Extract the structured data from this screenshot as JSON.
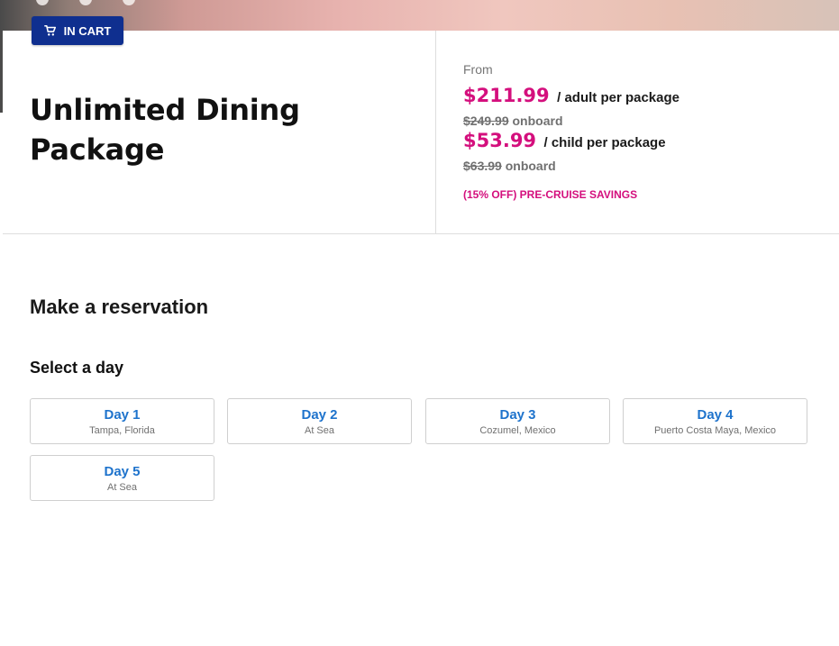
{
  "badge": {
    "label": "IN CART",
    "icon": "cart-icon"
  },
  "package": {
    "title": "Unlimited Dining Package",
    "from_label": "From",
    "adult_price": "$211.99",
    "adult_unit": "/ adult per package",
    "adult_onboard_price": "$249.99",
    "adult_onboard_label": "onboard",
    "child_price": "$53.99",
    "child_unit": "/ child per package",
    "child_onboard_price": "$63.99",
    "child_onboard_label": "onboard",
    "savings": "(15% OFF) PRE-CRUISE SAVINGS"
  },
  "reservation": {
    "title": "Make a reservation",
    "select_day_label": "Select a day",
    "days": [
      {
        "label": "Day 1",
        "location": "Tampa, Florida"
      },
      {
        "label": "Day 2",
        "location": "At Sea"
      },
      {
        "label": "Day 3",
        "location": "Cozumel, Mexico"
      },
      {
        "label": "Day 4",
        "location": "Puerto Costa Maya, Mexico"
      },
      {
        "label": "Day 5",
        "location": "At Sea"
      }
    ]
  },
  "colors": {
    "badge_background": "#0f2f8f",
    "accent_pink": "#d40f7d",
    "day_link_blue": "#1e73cc",
    "text_dark": "#111111",
    "text_muted": "#707070",
    "border": "#dedede"
  }
}
